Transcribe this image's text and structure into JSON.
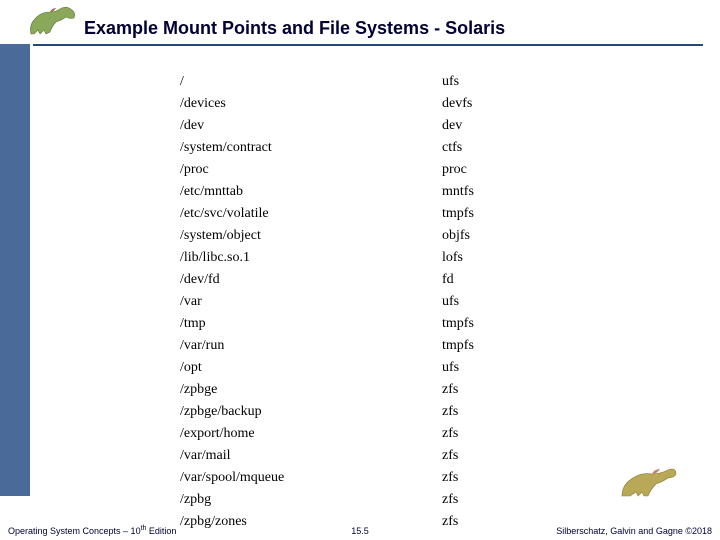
{
  "title": "Example Mount Points and File Systems - Solaris",
  "mounts": [
    {
      "mp": "/",
      "fs": "ufs"
    },
    {
      "mp": "/devices",
      "fs": "devfs"
    },
    {
      "mp": "/dev",
      "fs": "dev"
    },
    {
      "mp": "/system/contract",
      "fs": "ctfs"
    },
    {
      "mp": "/proc",
      "fs": "proc"
    },
    {
      "mp": "/etc/mnttab",
      "fs": "mntfs"
    },
    {
      "mp": "/etc/svc/volatile",
      "fs": "tmpfs"
    },
    {
      "mp": "/system/object",
      "fs": "objfs"
    },
    {
      "mp": "/lib/libc.so.1",
      "fs": "lofs"
    },
    {
      "mp": "/dev/fd",
      "fs": "fd"
    },
    {
      "mp": "/var",
      "fs": "ufs"
    },
    {
      "mp": "/tmp",
      "fs": "tmpfs"
    },
    {
      "mp": "/var/run",
      "fs": "tmpfs"
    },
    {
      "mp": "/opt",
      "fs": "ufs"
    },
    {
      "mp": "/zpbge",
      "fs": "zfs"
    },
    {
      "mp": "/zpbge/backup",
      "fs": "zfs"
    },
    {
      "mp": "/export/home",
      "fs": "zfs"
    },
    {
      "mp": "/var/mail",
      "fs": "zfs"
    },
    {
      "mp": "/var/spool/mqueue",
      "fs": "zfs"
    },
    {
      "mp": "/zpbg",
      "fs": "zfs"
    },
    {
      "mp": "/zpbg/zones",
      "fs": "zfs"
    }
  ],
  "footer": {
    "left_a": "Operating System Concepts – 10",
    "left_sup": "th",
    "left_b": " Edition",
    "center": "15.5",
    "right": "Silberschatz, Galvin and Gagne ©2018"
  },
  "colors": {
    "sidebar": "#4a6a9a",
    "underline": "#28487a",
    "titleText": "#000033"
  }
}
